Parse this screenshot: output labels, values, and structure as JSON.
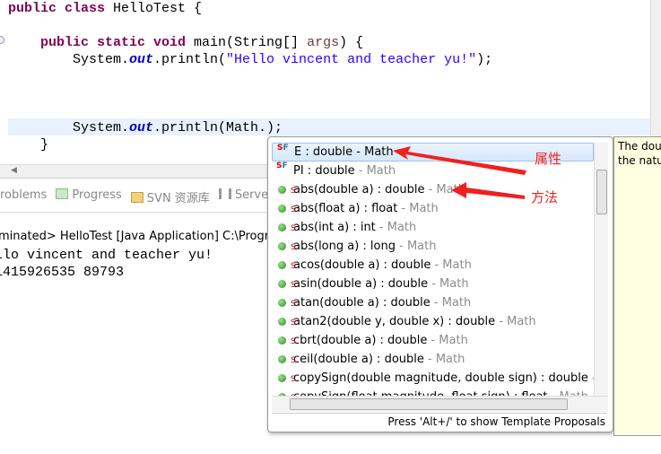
{
  "editor": {
    "line1": {
      "kw": "public class ",
      "rest": "HelloTest {"
    },
    "line2": {
      "kw": "public static void ",
      "a": "main(String[] ",
      "var": "args",
      "b": ") {"
    },
    "line3": {
      "a": "System.",
      "fld": "out",
      "b": ".println(",
      "str": "\"Hello vincent and teacher yu!\"",
      "c": ");"
    },
    "line4": {
      "a": "System.",
      "fld": "out",
      "b": ".println(Math.);"
    },
    "line5": "}"
  },
  "tabs": [
    "roblems",
    "Progress",
    "SVN 资源库",
    "Servers"
  ],
  "console": {
    "header": "minated> HelloTest [Java Application] C:\\Program Fi",
    "output": [
      "llo vincent and teacher yu!",
      "1415926535 89793"
    ]
  },
  "popup": {
    "items": [
      {
        "main": "E : double",
        "owner": " - Math",
        "kind": "field"
      },
      {
        "main": "PI : double",
        "owner": " - Math",
        "kind": "field"
      },
      {
        "main": "abs(double a) : double",
        "owner": " - Math",
        "kind": "method"
      },
      {
        "main": "abs(float a) : float",
        "owner": " - Math",
        "kind": "method"
      },
      {
        "main": "abs(int a) : int",
        "owner": " - Math",
        "kind": "method"
      },
      {
        "main": "abs(long a) : long",
        "owner": " - Math",
        "kind": "method"
      },
      {
        "main": "acos(double a) : double",
        "owner": " - Math",
        "kind": "method"
      },
      {
        "main": "asin(double a) : double",
        "owner": " - Math",
        "kind": "method"
      },
      {
        "main": "atan(double a) : double",
        "owner": " - Math",
        "kind": "method"
      },
      {
        "main": "atan2(double y, double x) : double",
        "owner": " - Math",
        "kind": "method"
      },
      {
        "main": "cbrt(double a) : double",
        "owner": " - Math",
        "kind": "method"
      },
      {
        "main": "ceil(double a) : double",
        "owner": " - Math",
        "kind": "method"
      },
      {
        "main": "copySign(double magnitude, double sign) : double",
        "owner": " - Math",
        "kind": "method"
      },
      {
        "main": "copySign(float magnitude, float sign) : float",
        "owner": " - Math",
        "kind": "method"
      }
    ],
    "status": "Press 'Alt+/' to show Template Proposals"
  },
  "tooltip": [
    "The double",
    "the natural"
  ],
  "annotations": {
    "field": "属性",
    "method": "方法",
    "color": "#f02020"
  }
}
